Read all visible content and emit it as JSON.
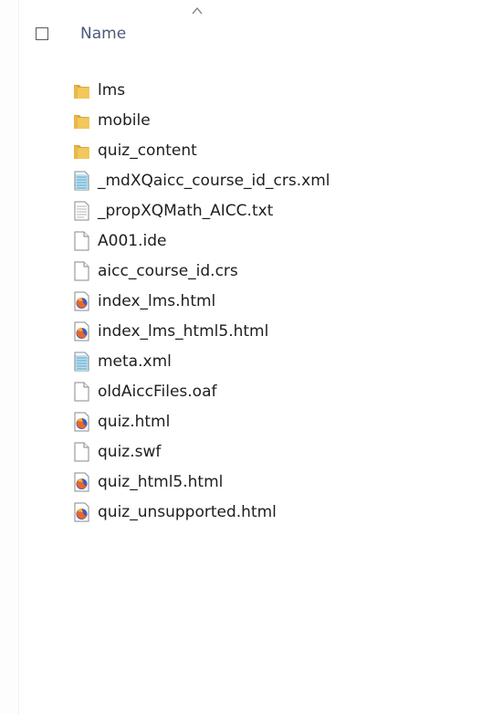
{
  "header": {
    "name_label": "Name"
  },
  "files": [
    {
      "name": "lms",
      "icon": "folder-icon"
    },
    {
      "name": "mobile",
      "icon": "folder-icon"
    },
    {
      "name": "quiz_content",
      "icon": "folder-icon"
    },
    {
      "name": "_mdXQaicc_course_id_crs.xml",
      "icon": "xml-file-icon"
    },
    {
      "name": "_propXQMath_AICC.txt",
      "icon": "text-file-icon"
    },
    {
      "name": "A001.ide",
      "icon": "blank-file-icon"
    },
    {
      "name": "aicc_course_id.crs",
      "icon": "blank-file-icon"
    },
    {
      "name": "index_lms.html",
      "icon": "firefox-html-file-icon"
    },
    {
      "name": "index_lms_html5.html",
      "icon": "firefox-html-file-icon"
    },
    {
      "name": "meta.xml",
      "icon": "xml-file-icon"
    },
    {
      "name": "oldAiccFiles.oaf",
      "icon": "blank-file-icon"
    },
    {
      "name": "quiz.html",
      "icon": "firefox-html-file-icon"
    },
    {
      "name": "quiz.swf",
      "icon": "blank-file-icon"
    },
    {
      "name": "quiz_html5.html",
      "icon": "firefox-html-file-icon"
    },
    {
      "name": "quiz_unsupported.html",
      "icon": "firefox-html-file-icon"
    }
  ],
  "colors": {
    "header_text": "#4a5a7b",
    "folder": "#e8b84a",
    "xml_accent": "#5aa6c8"
  }
}
